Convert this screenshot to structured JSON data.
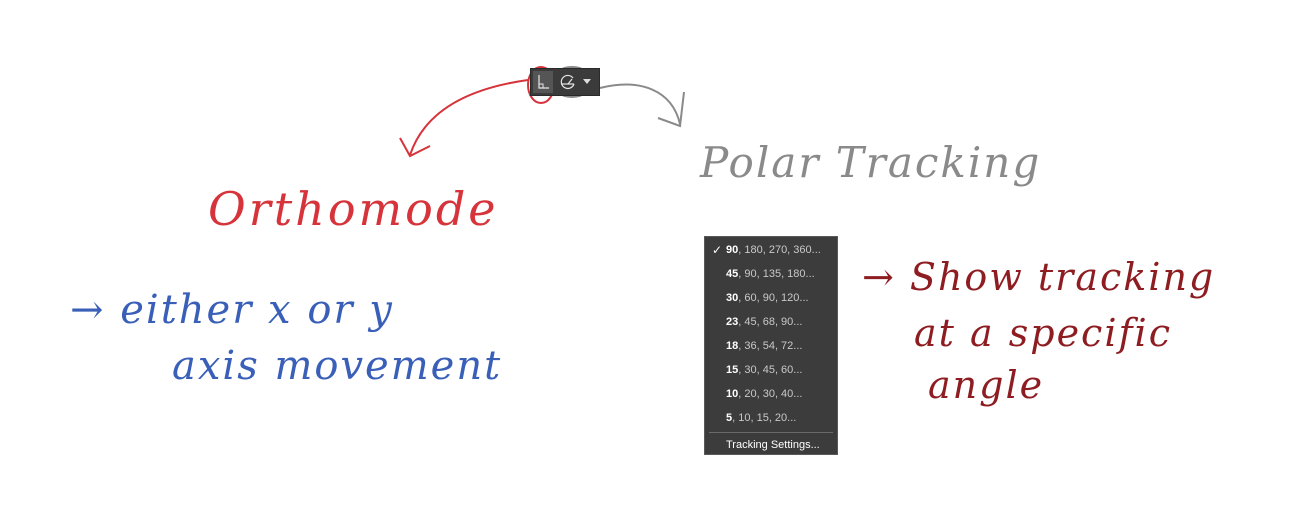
{
  "annotations": {
    "orthomode_label": "Orthomode",
    "polar_tracking_label": "Polar Tracking",
    "ortho_note_line1": "→ either x or y",
    "ortho_note_line2": "axis movement",
    "polar_note_line1": "→ Show tracking",
    "polar_note_line2": "at a specific",
    "polar_note_line3": "angle",
    "colors": {
      "ortho": "#d6333a",
      "polar": "#8a8a8a",
      "blue_note": "#3a5fb8",
      "red_note": "#8e1d22"
    }
  },
  "toolbar": {
    "ortho_icon": "ortho-icon",
    "polar_icon": "polar-icon",
    "dropdown_icon": "chevron-down-icon"
  },
  "polar_menu": {
    "items": [
      {
        "lead": "90",
        "rest": ", 180, 270, 360...",
        "checked": true
      },
      {
        "lead": "45",
        "rest": ", 90, 135, 180...",
        "checked": false
      },
      {
        "lead": "30",
        "rest": ", 60, 90, 120...",
        "checked": false
      },
      {
        "lead": "23",
        "rest": ", 45, 68, 90...",
        "checked": false
      },
      {
        "lead": "18",
        "rest": ", 36, 54, 72...",
        "checked": false
      },
      {
        "lead": "15",
        "rest": ", 30, 45, 60...",
        "checked": false
      },
      {
        "lead": "10",
        "rest": ", 20, 30, 40...",
        "checked": false
      },
      {
        "lead": "5",
        "rest": ", 10, 15, 20...",
        "checked": false
      }
    ],
    "check_mark": "✓",
    "settings_label": "Tracking Settings..."
  }
}
